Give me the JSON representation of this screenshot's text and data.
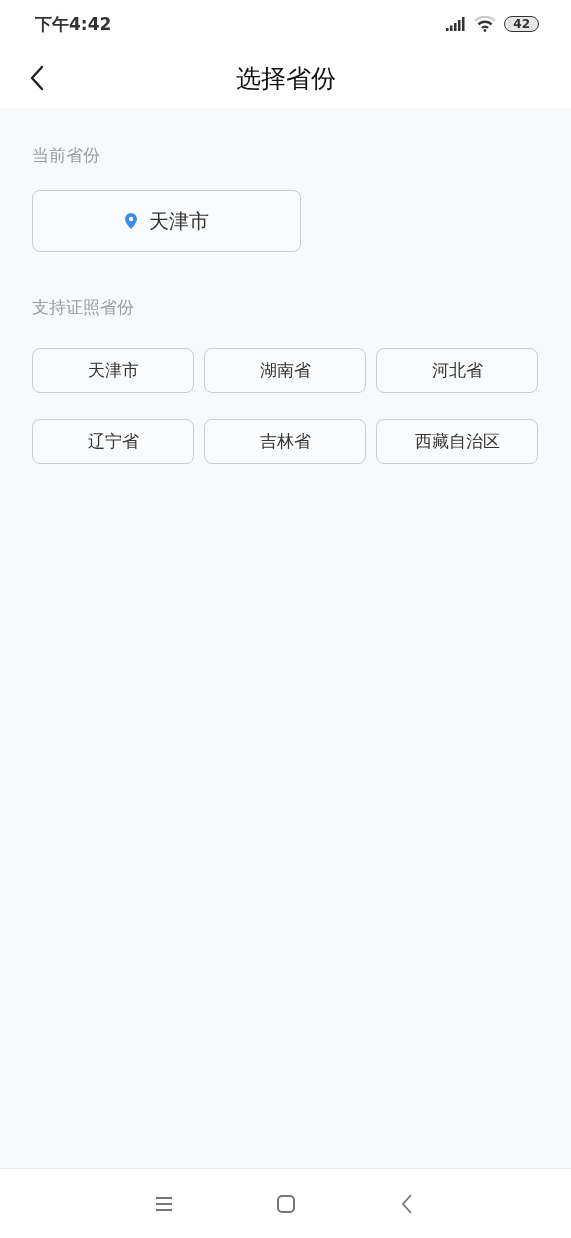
{
  "status_bar": {
    "time": "下午4:42",
    "battery": "42"
  },
  "header": {
    "title": "选择省份"
  },
  "current": {
    "label": "当前省份",
    "province": "天津市"
  },
  "supported": {
    "label": "支持证照省份",
    "provinces": [
      "天津市",
      "湖南省",
      "河北省",
      "辽宁省",
      "吉林省",
      "西藏自治区"
    ]
  }
}
